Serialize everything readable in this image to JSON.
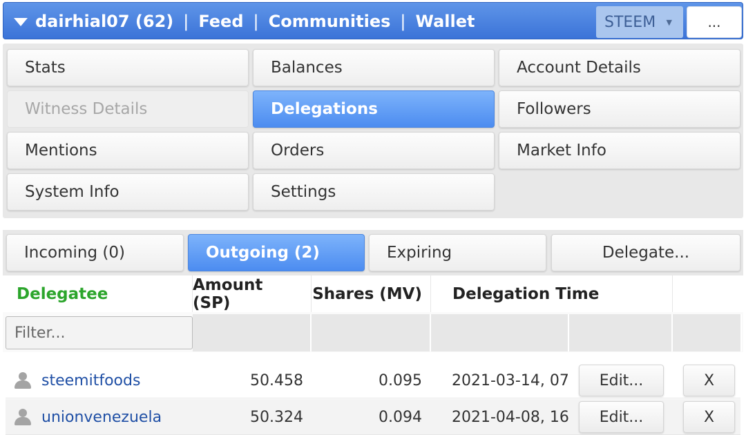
{
  "header": {
    "account": "dairhial07 (62)",
    "separator": "|",
    "links": [
      "Feed",
      "Communities",
      "Wallet"
    ],
    "coin_select": "STEEM",
    "more_label": "..."
  },
  "menu": {
    "items": [
      {
        "label": "Stats",
        "state": "normal"
      },
      {
        "label": "Balances",
        "state": "normal"
      },
      {
        "label": "Account Details",
        "state": "normal"
      },
      {
        "label": "Witness Details",
        "state": "disabled"
      },
      {
        "label": "Delegations",
        "state": "active"
      },
      {
        "label": "Followers",
        "state": "normal"
      },
      {
        "label": "Mentions",
        "state": "normal"
      },
      {
        "label": "Orders",
        "state": "normal"
      },
      {
        "label": "Market Info",
        "state": "normal"
      },
      {
        "label": "System Info",
        "state": "normal"
      },
      {
        "label": "Settings",
        "state": "normal"
      }
    ]
  },
  "tabs": {
    "items": [
      {
        "label": "Incoming (0)",
        "state": "normal"
      },
      {
        "label": "Outgoing (2)",
        "state": "active"
      },
      {
        "label": "Expiring",
        "state": "normal"
      },
      {
        "label": "Delegate...",
        "state": "normal"
      }
    ]
  },
  "table": {
    "columns": [
      "Delegatee",
      "Amount (SP)",
      "Shares (MV)",
      "Delegation Time"
    ],
    "filter_placeholder": "Filter...",
    "rows": [
      {
        "delegatee": "steemitfoods",
        "amount": "50.458",
        "shares": "0.095",
        "time": "2021-03-14, 07:",
        "edit": "Edit...",
        "remove": "X"
      },
      {
        "delegatee": "unionvenezuela",
        "amount": "50.324",
        "shares": "0.094",
        "time": "2021-04-08, 16:",
        "edit": "Edit...",
        "remove": "X"
      }
    ]
  },
  "colors": {
    "accent": "#3b73d8",
    "active_tab": "#4c8cf0",
    "delegatee_header": "#2ba52b",
    "link": "#1f4fa5"
  }
}
